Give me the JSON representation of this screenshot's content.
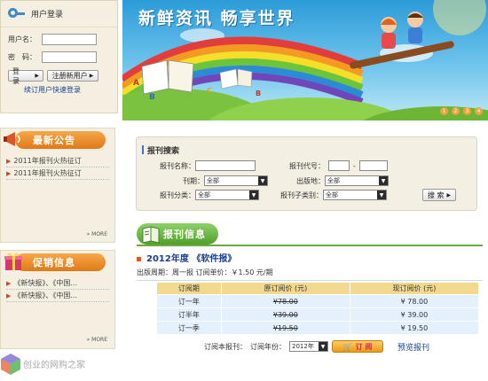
{
  "login": {
    "title": "用户登录",
    "username_label": "用户名：",
    "password_label": "密　码：",
    "login_btn": "登　录",
    "register_btn": "注册新用户",
    "renew_link": "续订用户快速登录"
  },
  "notice": {
    "title": "最新公告",
    "items": [
      "2011年报刊火热征订",
      "2011年报刊火热征订"
    ],
    "more": "MORE"
  },
  "promo": {
    "title": "促销信息",
    "items": [
      "《新快报》、《中国...",
      "《新快报》、《中国..."
    ],
    "more": "MORE"
  },
  "banner": {
    "title": "新鲜资讯 畅享世界",
    "dots": [
      "1",
      "2",
      "3",
      "4"
    ],
    "colors": {
      "sky": "#2c9bd8",
      "accent": "#f0a43b"
    }
  },
  "search": {
    "title": "报刊搜索",
    "name_label": "报刊名称：",
    "code_label": "报刊代号：",
    "period_label": "刊期：",
    "period_value": "全部",
    "place_label": "出版地：",
    "place_value": "全部",
    "category_label": "报刊分类：",
    "category_value": "全部",
    "subcategory_label": "报刊子类别：",
    "subcategory_value": "全部",
    "search_btn": "搜 索"
  },
  "subscription": {
    "tab_label": "报刊信息",
    "year_title": "2012年度 《软件报》",
    "issue_info": "出版周期：周一报  订阅单价：￥1.50 元/期",
    "columns": [
      "订阅期",
      "原订阅价 (元)",
      "现订阅价 (元)"
    ],
    "rows": [
      {
        "period": "订一年",
        "original": "¥78.00",
        "current": "¥ 78.00"
      },
      {
        "period": "订半年",
        "original": "¥39.00",
        "current": "¥ 39.00"
      },
      {
        "period": "订一季",
        "original": "¥19.50",
        "current": "¥ 19.50"
      }
    ],
    "order_label": "订阅本报刊：",
    "year_label": "订阅年份：",
    "year_value": "2012年",
    "order_btn": "订 阅",
    "preview_link": "预览报刊"
  },
  "watermark": "创业的网购之家",
  "icons": {
    "login": "key-icon",
    "notice": "megaphone-icon",
    "promo": "gift-icon",
    "subscription": "book-icon"
  }
}
